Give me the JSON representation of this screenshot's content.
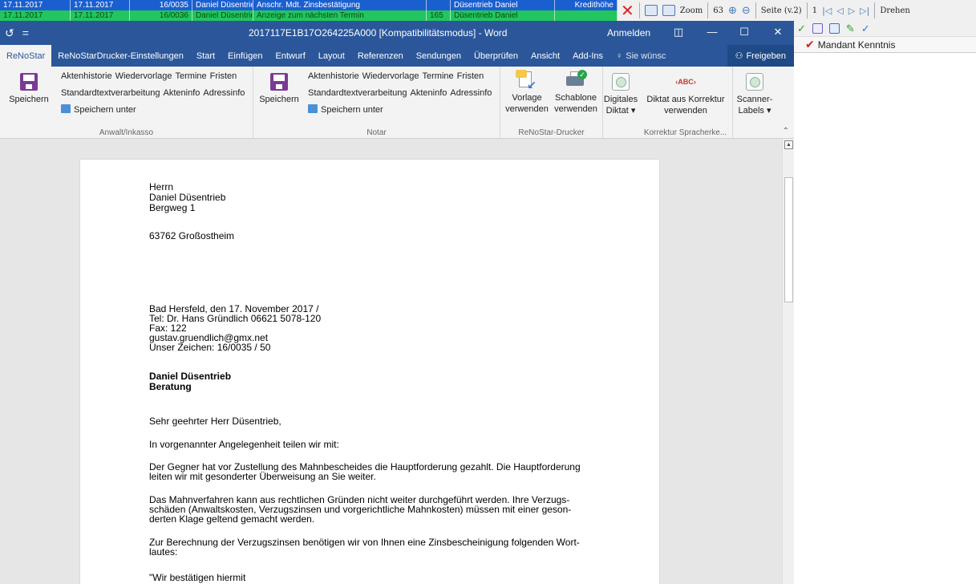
{
  "host": {
    "row1": [
      "17.11.2017",
      "17.11.2017",
      "16/0035",
      "Daniel Düsentrieb",
      "Anschr. Mdt. Zinsbestätigung",
      "",
      "Düsentrieb Daniel",
      "Kredithöhe"
    ],
    "row2": [
      "17.11.2017",
      "17.11.2017",
      "16/0036",
      "Daniel Düsentrieb",
      "Anzeige zum nächsten Termin",
      "165",
      "Düsentrieb Daniel",
      ""
    ],
    "toolbar": {
      "zoom_label": "Zoom",
      "zoom_value": "63",
      "page_label": "Seite (v.2)",
      "page_num": "1",
      "rotate_label": "Drehen"
    },
    "right_item": "Mandant Kenntnis"
  },
  "window": {
    "title": "2017117E1B17O264225A000 [Kompatibilitätsmodus] - Word",
    "signin": "Anmelden",
    "qat_undo": "↺",
    "qat_more": "="
  },
  "tabs": [
    {
      "label": "ReNoStar",
      "active": true
    },
    {
      "label": "ReNoStarDrucker-Einstellungen"
    },
    {
      "label": "Start"
    },
    {
      "label": "Einfügen"
    },
    {
      "label": "Entwurf"
    },
    {
      "label": "Layout"
    },
    {
      "label": "Referenzen"
    },
    {
      "label": "Sendungen"
    },
    {
      "label": "Überprüfen"
    },
    {
      "label": "Ansicht"
    },
    {
      "label": "Add-Ins"
    }
  ],
  "tell_me": "Sie wünsc",
  "share": "Freigeben",
  "ribbon": {
    "anwalt": {
      "save": "Speichern",
      "links_row1": [
        "Aktenhistorie",
        "Wiedervorlage",
        "Termine",
        "Fristen"
      ],
      "links_row2": [
        "Standardtextverarbeitung",
        "Akteninfo",
        "Adressinfo"
      ],
      "save_as": "Speichern unter",
      "label": "Anwalt/Inkasso"
    },
    "notar": {
      "save": "Speichern",
      "links_row1": [
        "Aktenhistorie",
        "Wiedervorlage",
        "Termine",
        "Fristen"
      ],
      "links_row2": [
        "Standardtextverarbeitung",
        "Akteninfo",
        "Adressinfo"
      ],
      "save_as": "Speichern unter",
      "label": "Notar"
    },
    "drucker": {
      "vorlage": [
        "Vorlage",
        "verwenden"
      ],
      "schablone": [
        "Schablone",
        "verwenden"
      ],
      "label": "ReNoStar-Drucker"
    },
    "digital": [
      "Digitales",
      "Diktat ▾"
    ],
    "korrektur": {
      "btn": [
        "Diktat aus Korrektur",
        "verwenden"
      ],
      "label": "Korrektur Spracherke..."
    },
    "scanner": [
      "Scanner-",
      "Labels ▾"
    ],
    "abc_icon": "‹ABC›"
  },
  "letter": {
    "recipient": [
      "Herrn",
      "Daniel Düsentrieb",
      "Bergweg 1"
    ],
    "city": "63762 Großostheim",
    "meta": [
      "Bad Hersfeld, den 17. November 2017 /",
      "Tel: Dr. Hans Gründlich 06621 5078-120",
      "Fax: 122",
      "gustav.gruendlich@gmx.net",
      "Unser Zeichen: 16/0035 / 50"
    ],
    "subject": [
      "Daniel Düsentrieb",
      "Beratung"
    ],
    "salutation": "Sehr geehrter Herr Düsentrieb,",
    "p1": "In vorgenannter Angelegenheit teilen wir mit:",
    "p2": [
      "Der Gegner hat vor Zustellung des Mahnbescheides die Hauptforderung gezahlt. Die Hauptforderung",
      "leiten wir mit gesonderter Überweisung an Sie weiter."
    ],
    "p3": [
      "Das Mahnverfahren kann aus rechtlichen Gründen nicht weiter durchgeführt werden. Ihre Verzugs-",
      "schäden (Anwaltskosten, Verzugszinsen und vorgerichtliche Mahnkosten) müssen mit einer geson-",
      "derten Klage geltend gemacht werden."
    ],
    "p4": [
      "Zur Berechnung der Verzugszinsen benötigen wir von Ihnen eine Zinsbescheinigung folgenden Wort-",
      "lautes:"
    ],
    "p5": "\"Wir bestätigen hiermit"
  },
  "colors": {
    "word_blue": "#2b579a",
    "host_blue": "#1a5fd0",
    "host_green": "#22c55e",
    "accent_purple": "#7b3a96"
  }
}
